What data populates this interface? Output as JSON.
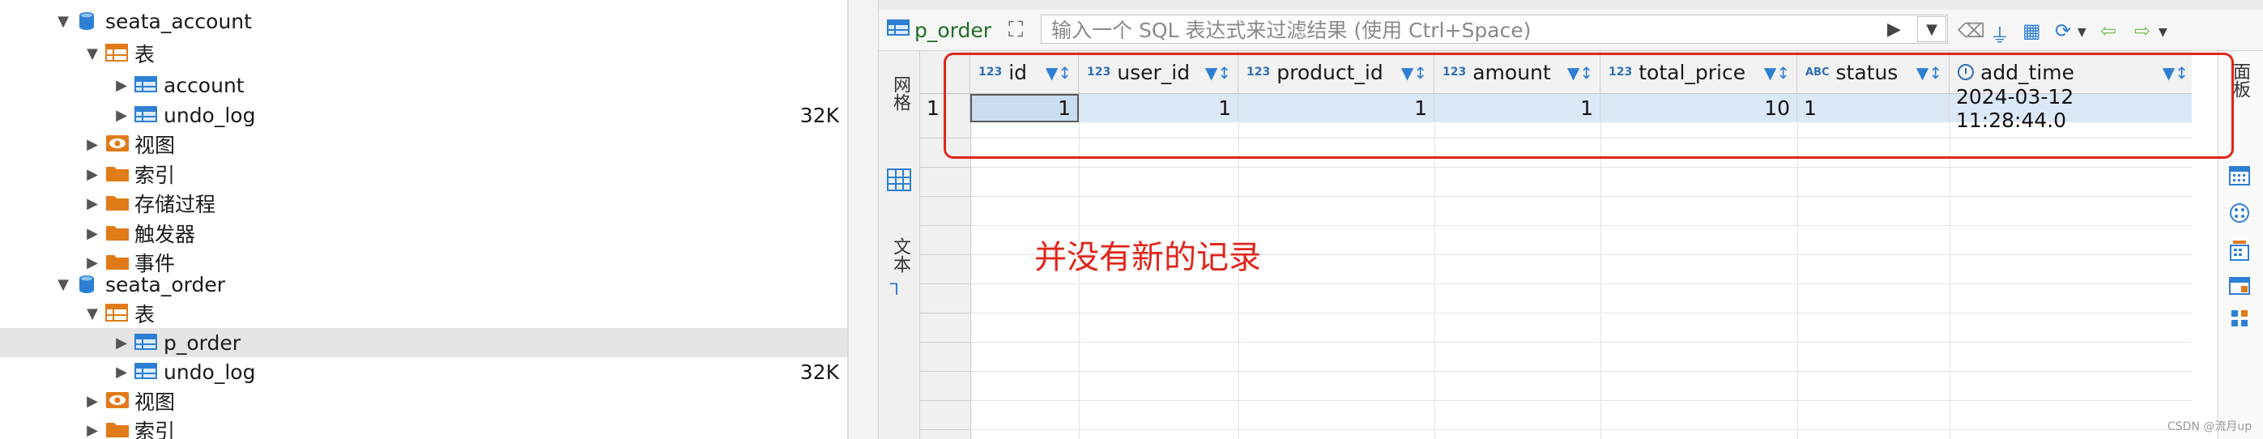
{
  "tree": {
    "rows": [
      {
        "label": "seata_account",
        "type": "database",
        "expanded": true,
        "indent": 0,
        "size": ""
      },
      {
        "label": "表",
        "type": "folder-table",
        "expanded": true,
        "indent": 1,
        "size": ""
      },
      {
        "label": "account",
        "type": "table",
        "expanded": false,
        "indent": 2,
        "size": ""
      },
      {
        "label": "undo_log",
        "type": "table",
        "expanded": false,
        "indent": 2,
        "size": "32K"
      },
      {
        "label": "视图",
        "type": "folder-view",
        "expanded": false,
        "indent": 1,
        "size": ""
      },
      {
        "label": "索引",
        "type": "folder",
        "expanded": false,
        "indent": 1,
        "size": ""
      },
      {
        "label": "存储过程",
        "type": "folder",
        "expanded": false,
        "indent": 1,
        "size": ""
      },
      {
        "label": "触发器",
        "type": "folder",
        "expanded": false,
        "indent": 1,
        "size": ""
      },
      {
        "label": "事件",
        "type": "folder",
        "expanded": false,
        "indent": 1,
        "size": ""
      },
      {
        "label": "seata_order",
        "type": "database",
        "expanded": true,
        "indent": 0,
        "size": ""
      },
      {
        "label": "表",
        "type": "folder-table",
        "expanded": true,
        "indent": 1,
        "size": ""
      },
      {
        "label": "p_order",
        "type": "table",
        "expanded": false,
        "indent": 2,
        "size": "",
        "selected": true
      },
      {
        "label": "undo_log",
        "type": "table",
        "expanded": false,
        "indent": 2,
        "size": "32K"
      },
      {
        "label": "视图",
        "type": "folder-view",
        "expanded": false,
        "indent": 1,
        "size": ""
      },
      {
        "label": "索引",
        "type": "folder",
        "expanded": false,
        "indent": 1,
        "size": ""
      }
    ]
  },
  "filterbar": {
    "table_name": "p_order",
    "filter_placeholder": "输入一个 SQL 表达式来过滤结果 (使用 Ctrl+Space)"
  },
  "sidetabs": {
    "grid_label": "网格",
    "text_label": "文本"
  },
  "grid": {
    "columns": [
      {
        "type": "123",
        "name": "id"
      },
      {
        "type": "123",
        "name": "user_id"
      },
      {
        "type": "123",
        "name": "product_id"
      },
      {
        "type": "123",
        "name": "amount"
      },
      {
        "type": "123",
        "name": "total_price"
      },
      {
        "type": "ABC",
        "name": "status"
      },
      {
        "type": "clock",
        "name": "add_time"
      }
    ],
    "rows": [
      {
        "row_number": "1",
        "cells": [
          "1",
          "1",
          "1",
          "1",
          "10",
          "1",
          "2024-03-12 11:28:44.0"
        ]
      }
    ]
  },
  "annotation": "并没有新的记录",
  "right_toolbar": {
    "top_label": "面板"
  },
  "watermark": "CSDN @流月up",
  "colors": {
    "accent": "#2d7fd4",
    "annotation_red": "#e0261b",
    "selected_row": "#dbe8f6"
  }
}
